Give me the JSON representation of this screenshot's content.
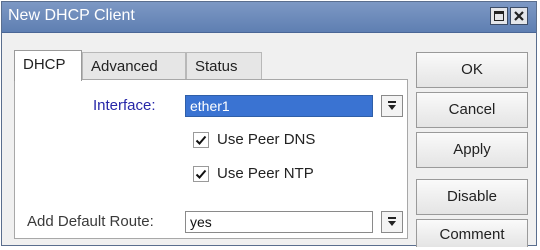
{
  "window": {
    "title": "New DHCP Client",
    "maximize_icon": "maximize-icon",
    "close_icon": "close-icon"
  },
  "tabs": [
    {
      "label": "DHCP",
      "active": true
    },
    {
      "label": "Advanced",
      "active": false
    },
    {
      "label": "Status",
      "active": false
    }
  ],
  "form": {
    "interface": {
      "label": "Interface:",
      "value": "ether1",
      "selected": true
    },
    "use_peer_dns": {
      "label": "Use Peer DNS",
      "checked": true
    },
    "use_peer_ntp": {
      "label": "Use Peer NTP",
      "checked": true
    },
    "add_default_route": {
      "label": "Add Default Route:",
      "value": "yes"
    }
  },
  "buttons": {
    "ok": "OK",
    "cancel": "Cancel",
    "apply": "Apply",
    "disable": "Disable",
    "comment": "Comment"
  },
  "colors": {
    "titlebar": "#6f8cbc",
    "selection": "#3a73d2",
    "label_highlight": "#2626a8"
  }
}
